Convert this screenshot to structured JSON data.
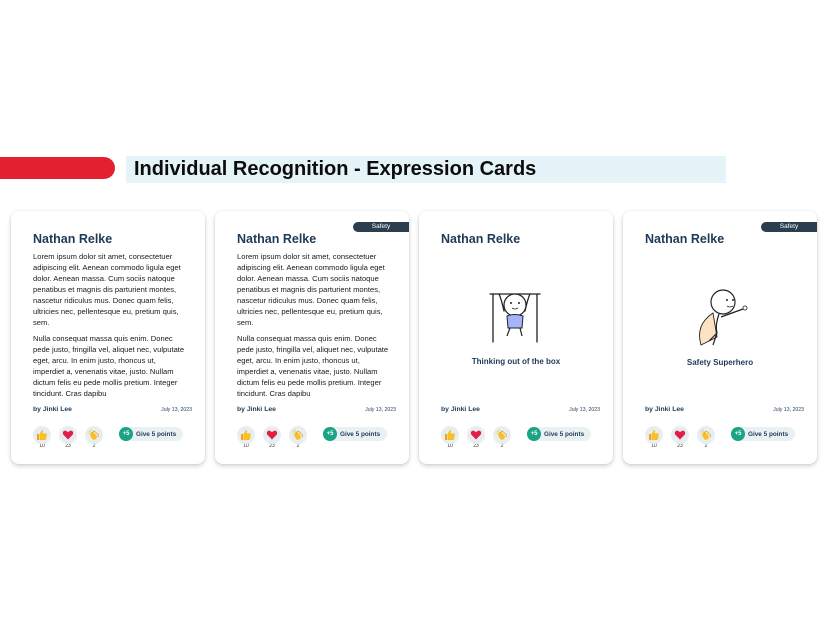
{
  "header": {
    "title": "Individual Recognition - Expression Cards"
  },
  "colors": {
    "accent_red": "#e3202f",
    "title_band": "#e4f4f8",
    "badge": "#2b3e50",
    "points_green": "#1aa385"
  },
  "cards": [
    {
      "name": "Nathan Relke",
      "badge": "",
      "paragraph1": "Lorem ipsum dolor sit amet, consectetuer adipiscing elit. Aenean commodo ligula eget dolor. Aenean massa. Cum sociis natoque penatibus et magnis dis parturient montes, nascetur ridiculus mus. Donec quam felis, ultricies nec, pellentesque eu, pretium quis, sem.",
      "paragraph2": "Nulla consequat massa quis enim. Donec pede justo, fringilla vel, aliquet nec, vulputate eget, arcu. In enim justo, rhoncus ut, imperdiet a, venenatis vitae, justo. Nullam dictum felis eu pede mollis pretium. Integer tincidunt. Cras dapibu",
      "author": "by Jinki Lee",
      "date": "July 13, 2023",
      "reactions": [
        {
          "icon": "thumbs-up-icon",
          "count": "10"
        },
        {
          "icon": "heart-icon",
          "count": "23"
        },
        {
          "icon": "clap-icon",
          "count": "2"
        }
      ],
      "give_points": {
        "badge": "+5",
        "label": "Give 5 points"
      }
    },
    {
      "name": "Nathan Relke",
      "badge": "Safety",
      "paragraph1": "Lorem ipsum dolor sit amet, consectetuer adipiscing elit. Aenean commodo ligula eget dolor. Aenean massa. Cum sociis natoque penatibus et magnis dis parturient montes, nascetur ridiculus mus. Donec quam felis, ultricies nec, pellentesque eu, pretium quis, sem.",
      "paragraph2": "Nulla consequat massa quis enim. Donec pede justo, fringilla vel, aliquet nec, vulputate eget, arcu. In enim justo, rhoncus ut, imperdiet a, venenatis vitae, justo. Nullam dictum felis eu pede mollis pretium. Integer tincidunt. Cras dapibu",
      "author": "by Jinki Lee",
      "date": "July 13, 2023",
      "reactions": [
        {
          "icon": "thumbs-up-icon",
          "count": "10"
        },
        {
          "icon": "heart-icon",
          "count": "23"
        },
        {
          "icon": "clap-icon",
          "count": "2"
        }
      ],
      "give_points": {
        "badge": "+5",
        "label": "Give 5 points"
      }
    },
    {
      "name": "Nathan Relke",
      "badge": "",
      "caption": "Thinking out of the box",
      "author": "by Jinki Lee",
      "date": "July 13, 2023",
      "reactions": [
        {
          "icon": "thumbs-up-icon",
          "count": "10"
        },
        {
          "icon": "heart-icon",
          "count": "23"
        },
        {
          "icon": "clap-icon",
          "count": "2"
        }
      ],
      "give_points": {
        "badge": "+5",
        "label": "Give 5 points"
      }
    },
    {
      "name": "Nathan Relke",
      "badge": "Safety",
      "caption": "Safety Superhero",
      "author": "by Jinki Lee",
      "date": "July 13, 2023",
      "reactions": [
        {
          "icon": "thumbs-up-icon",
          "count": "10"
        },
        {
          "icon": "heart-icon",
          "count": "23"
        },
        {
          "icon": "clap-icon",
          "count": "2"
        }
      ],
      "give_points": {
        "badge": "+5",
        "label": "Give 5 points"
      }
    }
  ]
}
